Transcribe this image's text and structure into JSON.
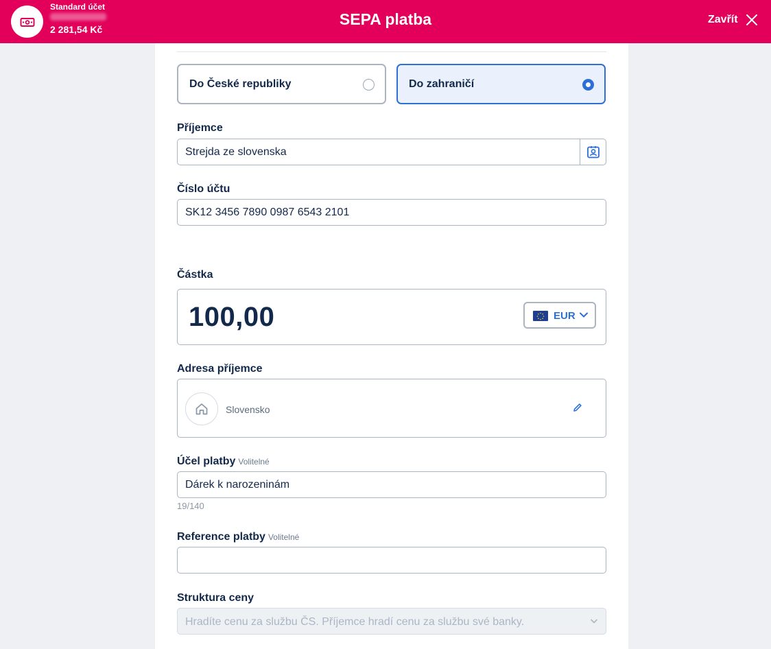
{
  "header": {
    "account_name": "Standard účet",
    "account_balance": "2 281,54 Kč",
    "title": "SEPA platba",
    "close_label": "Zavřít",
    "account_icon": "banknote-icon",
    "close_icon": "close-icon"
  },
  "destination": {
    "options": [
      {
        "label": "Do České republiky",
        "selected": false
      },
      {
        "label": "Do zahraničí",
        "selected": true
      }
    ]
  },
  "recipient": {
    "label": "Příjemce",
    "value": "Strejda ze slovenska",
    "contact_icon": "contact-card-icon"
  },
  "account_number": {
    "label": "Číslo účtu",
    "value": "SK12 3456 7890 0987 6543 2101"
  },
  "amount": {
    "label": "Částka",
    "value": "100,00",
    "currency": "EUR",
    "currency_icon": "eu-flag-icon"
  },
  "address": {
    "label": "Adresa příjemce",
    "value": "Slovensko",
    "icon": "house-icon",
    "edit_icon": "pencil-icon"
  },
  "purpose": {
    "label": "Účel platby",
    "optional": "Volitelné",
    "value": "Dárek k narozeninám",
    "counter": "19/140"
  },
  "reference": {
    "label": "Reference platby",
    "optional": "Volitelné",
    "value": ""
  },
  "fee_structure": {
    "label": "Struktura ceny",
    "placeholder": "Hradíte cenu za službu ČS. Příjemce hradí cenu za službu své banky."
  },
  "colors": {
    "brand": "#e2005a",
    "accent": "#2c6fd6",
    "text": "#13294b"
  }
}
